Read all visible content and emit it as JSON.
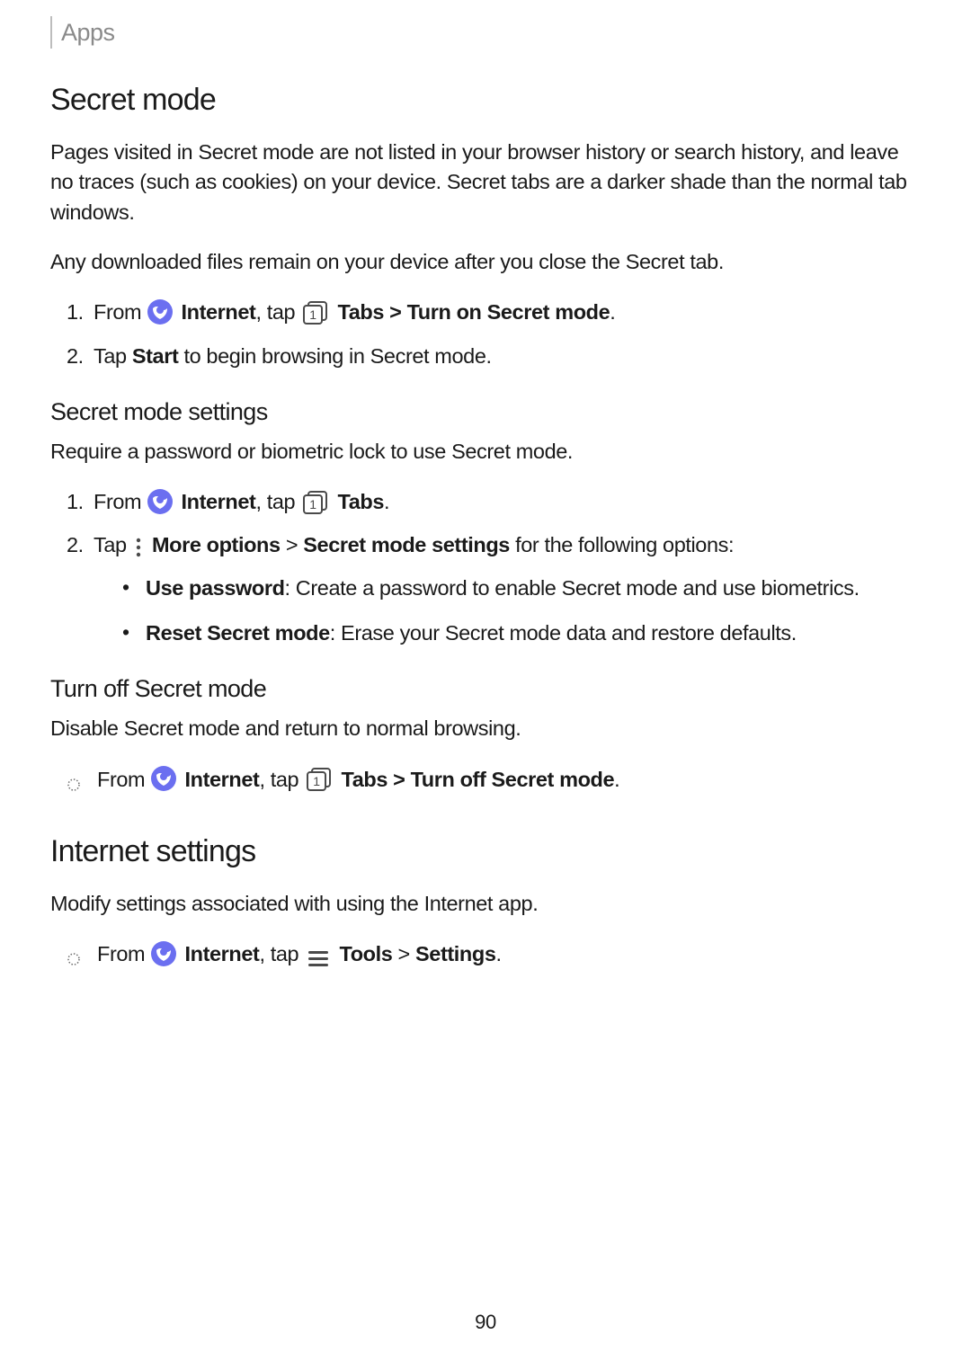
{
  "breadcrumb": "Apps",
  "pagenum": "90",
  "secret_mode": {
    "heading": "Secret mode",
    "p1": "Pages visited in Secret mode are not listed in your browser history or search history, and leave no traces (such as cookies) on your device. Secret tabs are a darker shade than the normal tab windows.",
    "p2": "Any downloaded files remain on your device after you close the Secret tab.",
    "step1_from": "From ",
    "step1_internet": "Internet",
    "step1_tap": ", tap ",
    "step1_tabs": "Tabs",
    "step1_turnon": " > Turn on Secret mode",
    "step1_period": ".",
    "step2_pre": "Tap ",
    "step2_start": "Start",
    "step2_post": " to begin browsing in Secret mode."
  },
  "settings": {
    "heading": "Secret mode settings",
    "p": "Require a password or biometric lock to use Secret mode.",
    "step1_from": "From ",
    "step1_internet": "Internet",
    "step1_tap": ", tap ",
    "step1_tabs": "Tabs",
    "step1_period": ".",
    "step2_tap": "Tap ",
    "step2_more": "More options",
    "step2_gt": " > ",
    "step2_sms": "Secret mode settings",
    "step2_post": " for the following options:",
    "opt1_label": "Use password",
    "opt1_desc": ": Create a password to enable Secret mode and use biometrics.",
    "opt2_label": "Reset Secret mode",
    "opt2_desc": ": Erase your Secret mode data and restore defaults."
  },
  "turnoff": {
    "heading": "Turn off Secret mode",
    "p": "Disable Secret mode and return to normal browsing.",
    "item_from": "From ",
    "item_internet": "Internet",
    "item_tap": ", tap ",
    "item_tabs": "Tabs",
    "item_turnoff": " > Turn off Secret mode",
    "item_period": "."
  },
  "internet_settings": {
    "heading": "Internet settings",
    "p": "Modify settings associated with using the Internet app.",
    "item_from": "From ",
    "item_internet": "Internet",
    "item_tap": ", tap ",
    "item_tools": "Tools",
    "item_gt": " > ",
    "item_settings": "Settings",
    "item_period": "."
  }
}
